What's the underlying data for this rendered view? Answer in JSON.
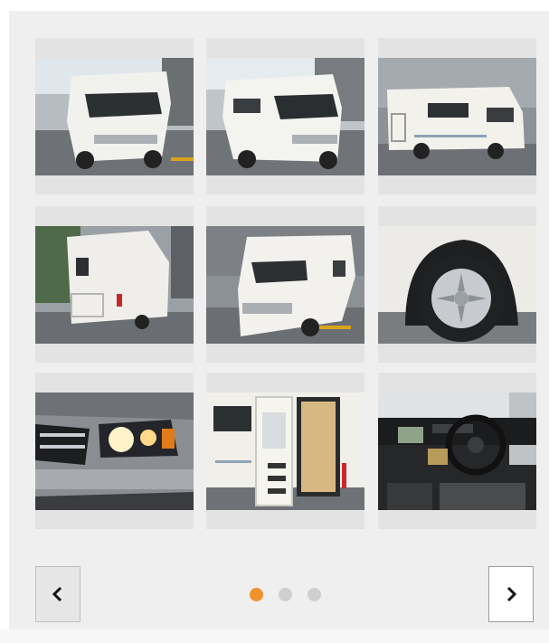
{
  "gallery": {
    "photos": [
      {
        "name": "photo-front-left"
      },
      {
        "name": "photo-front-right"
      },
      {
        "name": "photo-side"
      },
      {
        "name": "photo-rear"
      },
      {
        "name": "photo-front-angle"
      },
      {
        "name": "photo-wheel"
      },
      {
        "name": "photo-headlight"
      },
      {
        "name": "photo-entry-door"
      },
      {
        "name": "photo-dashboard"
      }
    ],
    "pagination": {
      "pages": 3,
      "current": 1
    },
    "icons": {
      "prev": "chevron-left-icon",
      "next": "chevron-right-icon"
    },
    "colors": {
      "active_dot": "#f0922e",
      "inactive_dot": "#cfcfcf",
      "panel": "#efefef"
    }
  }
}
